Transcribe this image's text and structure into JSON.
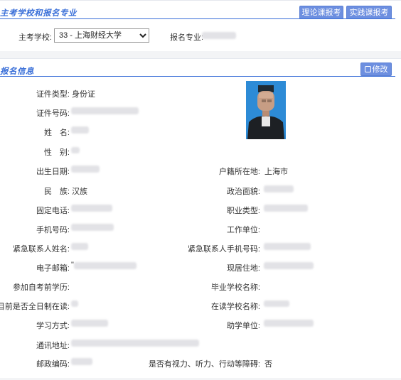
{
  "section1": {
    "title": "主考学校和报名专业",
    "btn_theory": "理论课报考",
    "btn_practice": "实践课报考",
    "school_label": "主考学校:",
    "school_value": "33 - 上海财经大学",
    "major_label": "报名专业:"
  },
  "section2": {
    "title": "报名信息",
    "edit_button": "修改",
    "id_type_label": "证件类型:",
    "id_type_value": "身份证",
    "id_number_label": "证件号码:",
    "name_label": "姓　名:",
    "gender_label": "性　别:",
    "birthdate_label": "出生日期:",
    "household_label": "户籍所在地:",
    "household_value": "上海市",
    "ethnicity_label": "民　族:",
    "ethnicity_value": "汉族",
    "political_label": "政治面貌:",
    "phone_label": "固定电话:",
    "occupation_label": "职业类型:",
    "mobile_label": "手机号码:",
    "workplace_label": "工作单位:",
    "emergency_name_label": "紧急联系人姓名:",
    "emergency_phone_label": "紧急联系人手机号码:",
    "email_label": "电子邮箱:",
    "email_prefix": "\"",
    "address_label": "现居住地:",
    "education_label": "参加自考前学历:",
    "graduate_school_label": "毕业学校名称:",
    "fulltime_label": "目前是否全日制在读:",
    "current_school_label": "在读学校名称:",
    "study_mode_label": "学习方式:",
    "assist_unit_label": "助学单位:",
    "mail_address_label": "通讯地址:",
    "postcode_label": "邮政编码:",
    "disability_label": "是否有视力、听力、行动等障碍:",
    "disability_value": "否"
  }
}
